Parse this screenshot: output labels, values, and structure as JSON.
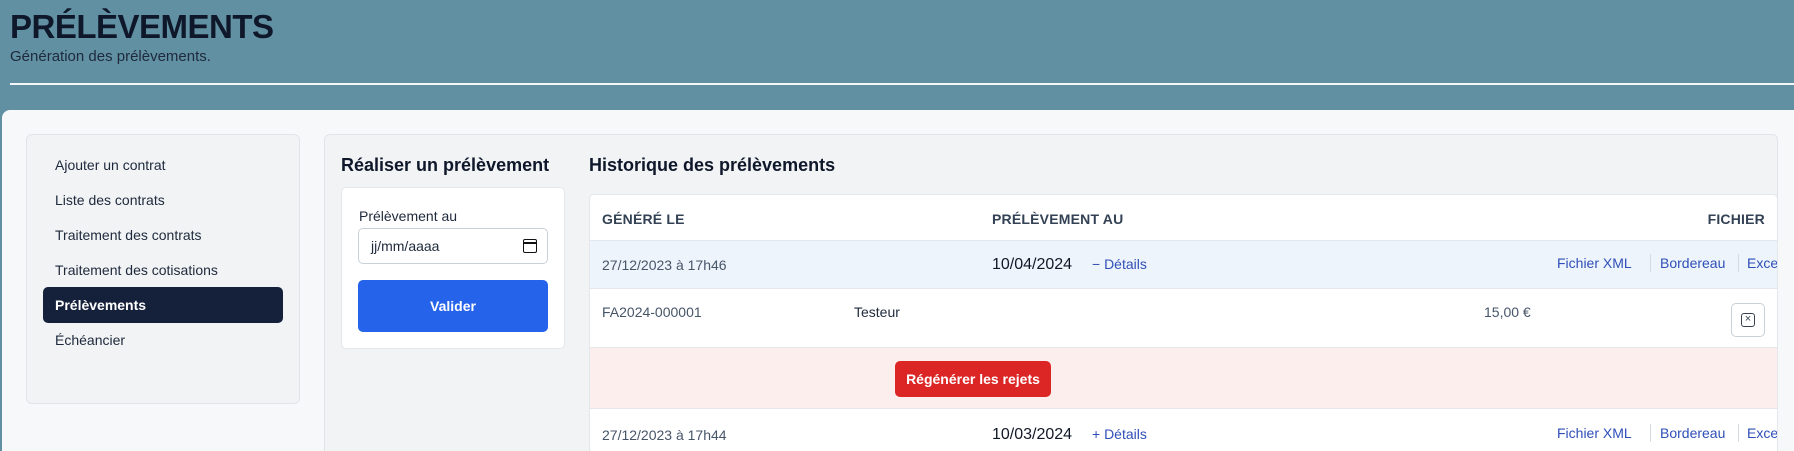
{
  "header": {
    "title": "PRÉLÈVEMENTS",
    "subtitle": "Génération des prélèvements."
  },
  "sidebar": {
    "items": [
      {
        "label": "Ajouter un contrat",
        "active": false
      },
      {
        "label": "Liste des contrats",
        "active": false
      },
      {
        "label": "Traitement des contrats",
        "active": false
      },
      {
        "label": "Traitement des cotisations",
        "active": false
      },
      {
        "label": "Prélèvements",
        "active": true
      },
      {
        "label": "Échéancier",
        "active": false
      }
    ]
  },
  "form": {
    "title": "Réaliser un prélèvement",
    "date_label": "Prélèvement au",
    "date_placeholder": "jj/mm/aaaa",
    "submit_label": "Valider"
  },
  "history": {
    "title": "Historique des prélèvements",
    "columns": {
      "generated": "GÉNÉRÉ LE",
      "withdrawal": "PRÉLÈVEMENT AU",
      "file": "FICHIER"
    },
    "rows": [
      {
        "generated": "27/12/2023 à 17h46",
        "withdrawal_date": "10/04/2024",
        "details_label": "− Détails",
        "expanded": true,
        "links": [
          "Fichier XML",
          "Bordereau",
          "Excel"
        ],
        "detail_line": {
          "reference": "FA2024-000001",
          "name": "Testeur",
          "amount": "15,00 €"
        },
        "regen_label": "Régénérer les rejets"
      },
      {
        "generated": "27/12/2023 à 17h44",
        "withdrawal_date": "10/03/2024",
        "details_label": "+ Détails",
        "expanded": false,
        "links": [
          "Fichier XML",
          "Bordereau",
          "Excel"
        ]
      }
    ]
  },
  "colors": {
    "header_bg": "#6090a2",
    "active_nav": "#15213b",
    "primary_button": "#2563eb",
    "danger_button": "#dc2626",
    "link": "#2f4fb8"
  },
  "icons": {
    "date_picker": "calendar-icon",
    "remove_line": "close-box-icon"
  }
}
